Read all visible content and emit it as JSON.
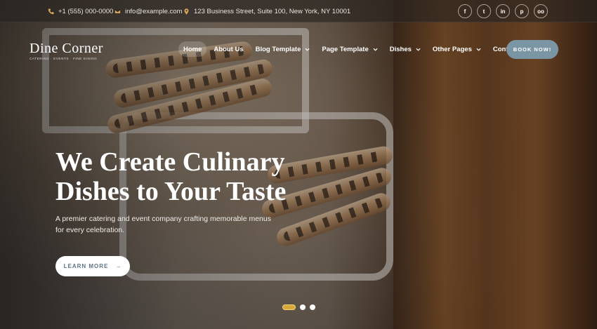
{
  "topbar": {
    "phone": "+1 (555) 000-0000",
    "email": "info@example.com",
    "address": "123 Business Street, Suite 100, New York, NY 10001",
    "socials": [
      {
        "icon": "facebook-icon",
        "glyph": "f"
      },
      {
        "icon": "twitter-icon",
        "glyph": "t"
      },
      {
        "icon": "linkedin-icon",
        "glyph": "in"
      },
      {
        "icon": "pinterest-icon",
        "glyph": "p"
      },
      {
        "icon": "tripadvisor-icon",
        "glyph": "oo"
      }
    ]
  },
  "logo": {
    "name": "Dine Corner",
    "tagline": "CATERING  ·  EVENTS  ·  FINE DINING"
  },
  "nav": {
    "items": [
      {
        "label": "Home",
        "active": true,
        "dropdown": false
      },
      {
        "label": "About Us",
        "active": false,
        "dropdown": false
      },
      {
        "label": "Blog Template",
        "active": false,
        "dropdown": true
      },
      {
        "label": "Page Template",
        "active": false,
        "dropdown": true
      },
      {
        "label": "Dishes",
        "active": false,
        "dropdown": true
      },
      {
        "label": "Other Pages",
        "active": false,
        "dropdown": true
      },
      {
        "label": "Contact Us",
        "active": false,
        "dropdown": false
      }
    ],
    "book_label": "BOOK NOW!"
  },
  "hero": {
    "headline_line1": "We Create Culinary",
    "headline_line2": "Dishes to Your Taste",
    "subtitle": "A premier catering and event company crafting memorable menus for every celebration.",
    "cta_label": "LEARN MORE",
    "cta_arrow": "→"
  },
  "slider": {
    "slides": 3,
    "active_index": 0
  },
  "colors": {
    "accent": "#d8a83a",
    "button_blue": "#7a95a4",
    "icon_gold": "#d9a85a"
  }
}
